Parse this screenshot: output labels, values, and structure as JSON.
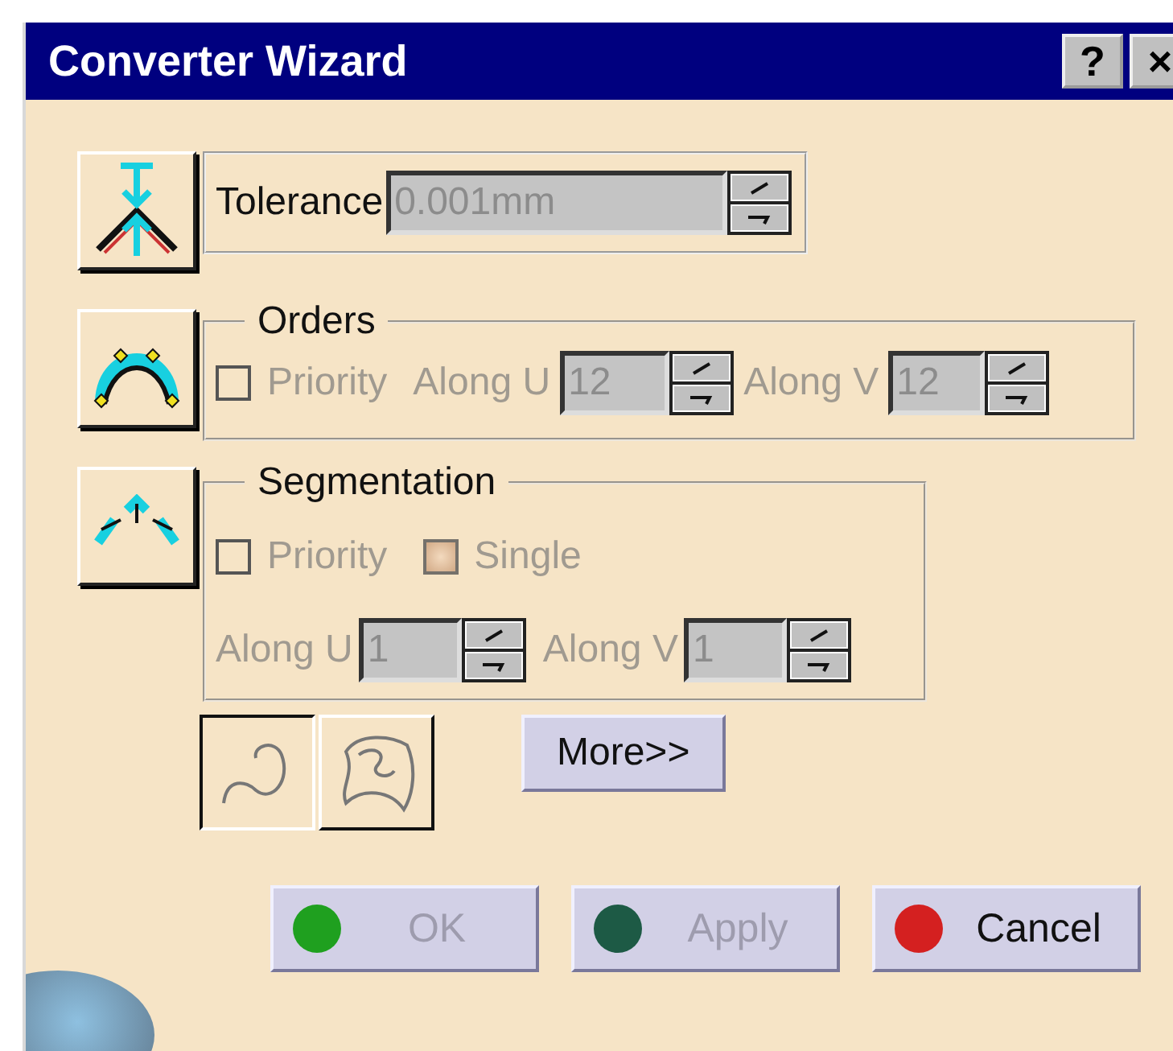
{
  "window": {
    "title": "Converter Wizard",
    "buttons": [
      "?",
      "×"
    ]
  },
  "tolerance": {
    "label": "Tolerance",
    "value": "0.001mm",
    "disabled": true
  },
  "orders": {
    "title": "Orders",
    "priority": {
      "label": "Priority",
      "checked": false,
      "disabled": true
    },
    "along_u": {
      "label": "Along U",
      "value": "12",
      "disabled": true
    },
    "along_v": {
      "label": "Along V",
      "value": "12",
      "disabled": true
    }
  },
  "segmentation": {
    "title": "Segmentation",
    "priority": {
      "label": "Priority",
      "checked": false,
      "disabled": true
    },
    "single": {
      "label": "Single",
      "checked": true,
      "disabled": true
    },
    "along_u": {
      "label": "Along U",
      "value": "1",
      "disabled": true
    },
    "along_v": {
      "label": "Along V",
      "value": "1",
      "disabled": true
    }
  },
  "mode_buttons": [
    {
      "kind": "curve",
      "selected": true
    },
    {
      "kind": "surface",
      "selected": false
    }
  ],
  "more_button": "More>>",
  "actions": [
    {
      "label": "OK",
      "color": "#1fa01f",
      "disabled": true
    },
    {
      "label": "Apply",
      "color": "#1d5a45",
      "disabled": true
    },
    {
      "label": "Cancel",
      "color": "#d42020",
      "disabled": false
    }
  ]
}
